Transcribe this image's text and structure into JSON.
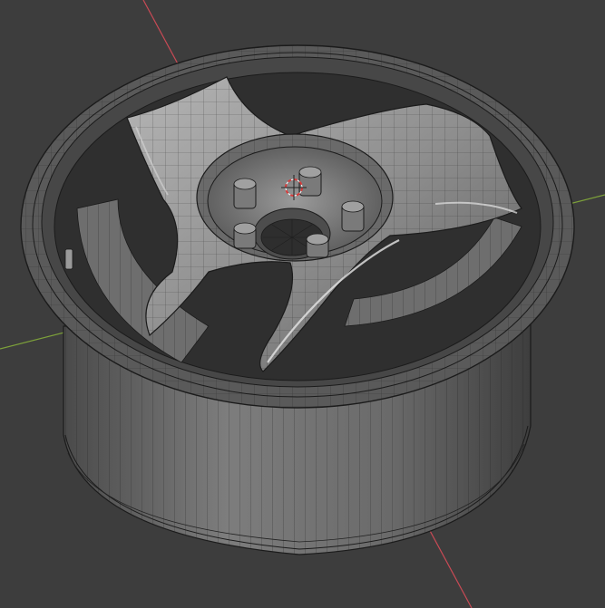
{
  "viewport": {
    "background": "#3d3d3d",
    "grid_line_color": "#4a4a4a",
    "x_axis_color": "#c94a55",
    "y_axis_color": "#7da13a",
    "cursor_color": "#d63b3b",
    "mesh_fill": "#8a8a8a",
    "mesh_dark": "#3a3a3a",
    "mesh_light": "#cfcfcf",
    "wire_color": "#1b1b1b"
  },
  "objects": [
    {
      "name": "wheel-rim",
      "type": "mesh"
    },
    {
      "name": "lug-nuts",
      "count": 5
    }
  ],
  "icons": [
    "3d-cursor-icon"
  ]
}
